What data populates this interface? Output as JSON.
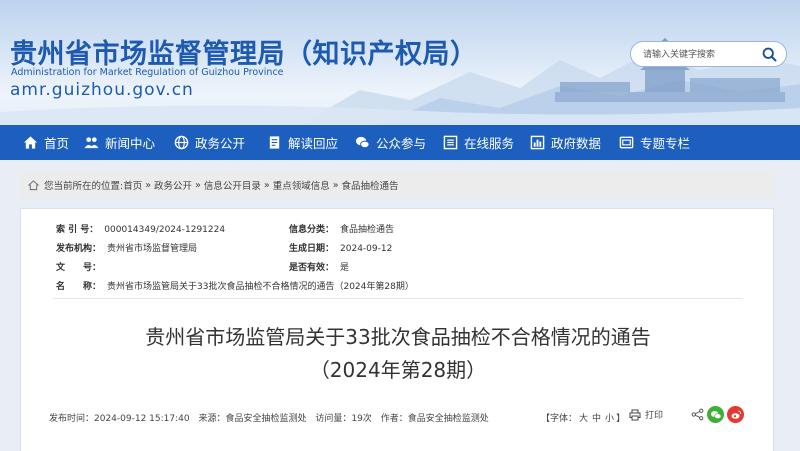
{
  "header": {
    "title": "贵州省市场监督管理局（知识产权局）",
    "title_en": "Administration for Market Regulation of Guizhou Province",
    "domain": "amr.guizhou.gov.cn",
    "search_placeholder": "请输入关键字搜索"
  },
  "nav": {
    "items": [
      {
        "label": "首页",
        "icon": "home-icon"
      },
      {
        "label": "新闻中心",
        "icon": "people-icon"
      },
      {
        "label": "政务公开",
        "icon": "globe-icon"
      },
      {
        "label": "解读回应",
        "icon": "document-icon"
      },
      {
        "label": "公众参与",
        "icon": "chat-icon"
      },
      {
        "label": "在线服务",
        "icon": "list-icon"
      },
      {
        "label": "政府数据",
        "icon": "chart-icon"
      },
      {
        "label": "专题专栏",
        "icon": "window-icon"
      }
    ]
  },
  "breadcrumb": {
    "prefix": "您当前所在的位置:",
    "items": [
      "首页",
      "政务公开",
      "信息公开目录",
      "重点领域信息",
      "食品抽检通告"
    ],
    "separator": "»"
  },
  "meta": {
    "index_label": "索 引 号：",
    "index_value": "000014349/2024-1291224",
    "category_label": "信息分类：",
    "category_value": "食品抽检通告",
    "publisher_label": "发布机构：",
    "publisher_value": "贵州省市场监督管理局",
    "date_label": "生成日期：",
    "date_value": "2024-09-12",
    "docno_label": "文　　号：",
    "docno_value": "",
    "valid_label": "是否有效：",
    "valid_value": "是",
    "name_label": "名　　称：",
    "name_value": "贵州省市场监管局关于33批次食品抽检不合格情况的通告（2024年第28期）"
  },
  "article": {
    "title_line1": "贵州省市场监管局关于33批次食品抽检不合格情况的通告",
    "title_line2": "（2024年第28期）"
  },
  "info": {
    "publish_time": "发布时间：2024-09-12 15:17:40",
    "source": "来源：食品安全抽检监测处",
    "visits": "访问量：19次",
    "author": "作者：食品安全抽检监测处",
    "fontsize_open": "【字体：",
    "fontsize_options": [
      "大",
      "中",
      "小"
    ],
    "fontsize_close": "】",
    "print_label": "打印"
  },
  "colors": {
    "brand_blue": "#1d5fbf",
    "title_blue": "#1e5bb0",
    "wechat_green": "#3cb034",
    "weibo_red": "#e6382f"
  }
}
